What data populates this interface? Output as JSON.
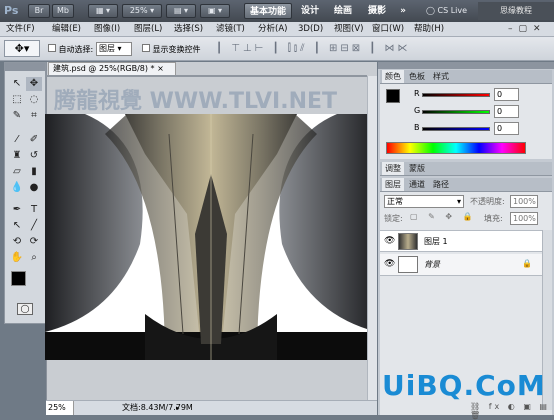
{
  "app": {
    "logo": "Ps"
  },
  "topbar": {
    "bridge": "Br",
    "mini": "Mb",
    "zoom": "25%",
    "workspaces": [
      "基本功能",
      "设计",
      "绘画",
      "摄影"
    ],
    "more": "»",
    "cslive": "CS Live",
    "watermark": "思缘教程 bbs.16xx8.com"
  },
  "menu": [
    "文件(F)",
    "编辑(E)",
    "图像(I)",
    "图层(L)",
    "选择(S)",
    "滤镜(T)",
    "分析(A)",
    "3D(D)",
    "视图(V)",
    "窗口(W)",
    "帮助(H)"
  ],
  "options": {
    "auto_select": "自动选择:",
    "auto_select_value": "图层",
    "show_transform": "显示变换控件"
  },
  "document": {
    "tab": "建筑.psd @ 25%(RGB/8) *",
    "close": "×",
    "watermark": "腾龍視覺 WWW.TLVI.NET",
    "status_zoom": "25%",
    "status_doc": "文档:8.43M/7.79M"
  },
  "panels": {
    "color_tabs": [
      "颜色",
      "色板",
      "样式"
    ],
    "r_label": "R",
    "g_label": "G",
    "b_label": "B",
    "r_value": "0",
    "g_value": "0",
    "b_value": "0",
    "adjust_tabs": [
      "调整",
      "蒙版"
    ],
    "layer_tabs": [
      "图层",
      "通道",
      "路径"
    ],
    "blend_mode": "正常",
    "opacity_label": "不透明度:",
    "opacity_value": "100%",
    "lock_label": "锁定:",
    "fill_label": "填充:",
    "fill_value": "100%",
    "layers": [
      {
        "name": "图层 1"
      },
      {
        "name": "背景"
      }
    ]
  },
  "footer_watermark": "UiBQ.CoM",
  "colors": {
    "accent": "#1a8bd4",
    "fg": "#000000",
    "bg": "#ffffff"
  }
}
